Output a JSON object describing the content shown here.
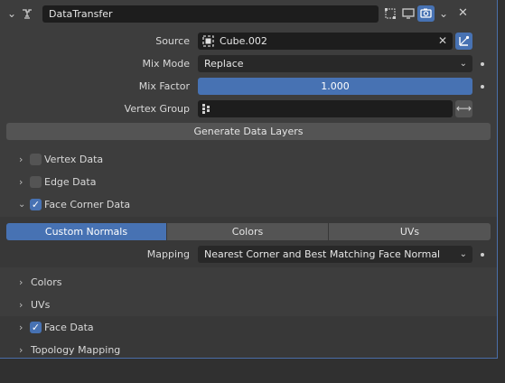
{
  "header": {
    "modifier_name": "DataTransfer",
    "icons": [
      "collapse-chevron-icon",
      "modifier-wrench-icon",
      "edit-mode-icon",
      "viewport-icon",
      "render-camera-icon",
      "extra-chevron-icon",
      "close-icon"
    ]
  },
  "source": {
    "label": "Source",
    "value": "Cube.002",
    "icon": "mesh-cube-icon"
  },
  "mix_mode": {
    "label": "Mix Mode",
    "value": "Replace"
  },
  "mix_factor": {
    "label": "Mix Factor",
    "value": "1.000"
  },
  "vertex_group": {
    "label": "Vertex Group",
    "value": ""
  },
  "generate_button": "Generate Data Layers",
  "sections": {
    "vertex_data": {
      "label": "Vertex Data",
      "checked": false
    },
    "edge_data": {
      "label": "Edge Data",
      "checked": false
    },
    "face_corner_data": {
      "label": "Face Corner Data",
      "checked": true
    }
  },
  "face_corner_tabs": [
    "Custom Normals",
    "Colors",
    "UVs"
  ],
  "mapping": {
    "label": "Mapping",
    "value": "Nearest Corner and Best Matching Face Normal"
  },
  "subsections": {
    "colors": "Colors",
    "uvs": "UVs"
  },
  "face_data": {
    "label": "Face Data",
    "checked": true
  },
  "topology_mapping": {
    "label": "Topology Mapping"
  },
  "colors": {
    "accent": "#4772b3",
    "panel_bg": "#3d3d3d",
    "field_bg": "#1d1d1d"
  }
}
